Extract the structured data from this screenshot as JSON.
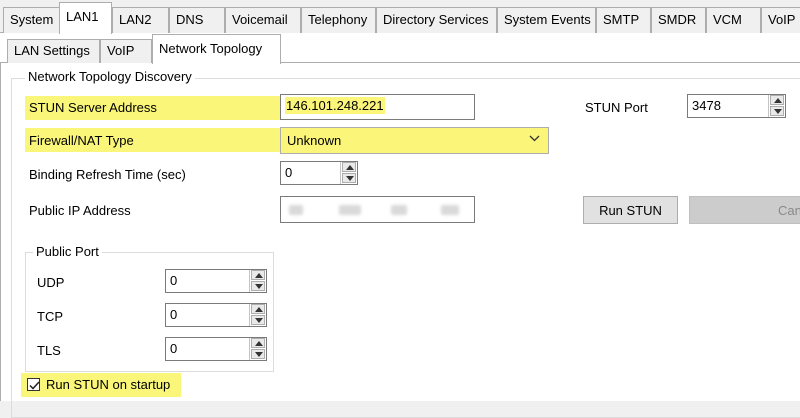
{
  "top_tabs": [
    "System",
    "LAN1",
    "LAN2",
    "DNS",
    "Voicemail",
    "Telephony",
    "Directory Services",
    "System Events",
    "SMTP",
    "SMDR",
    "VCM",
    "VoIP"
  ],
  "active_top_tab": "LAN1",
  "sub_tabs": [
    "LAN Settings",
    "VoIP",
    "Network Topology"
  ],
  "active_sub_tab": "Network Topology",
  "group_title": "Network Topology Discovery",
  "stun_server": {
    "label": "STUN Server Address",
    "value": "146.101.248.221"
  },
  "stun_port": {
    "label": "STUN Port",
    "value": "3478"
  },
  "firewall": {
    "label": "Firewall/NAT Type",
    "value": "Unknown"
  },
  "binding": {
    "label": "Binding Refresh Time (sec)",
    "value": "0"
  },
  "public_ip": {
    "label": "Public IP Address"
  },
  "buttons": {
    "run_stun": "Run STUN",
    "cancel": "Can"
  },
  "public_port": {
    "title": "Public Port",
    "udp": {
      "label": "UDP",
      "value": "0"
    },
    "tcp": {
      "label": "TCP",
      "value": "0"
    },
    "tls": {
      "label": "TLS",
      "value": "0"
    }
  },
  "run_on_startup": {
    "label": "Run STUN on startup",
    "checked": true
  },
  "colors": {
    "highlight": "#faf67a",
    "window_bg": "#f0f0f0",
    "border": "#adadad"
  }
}
